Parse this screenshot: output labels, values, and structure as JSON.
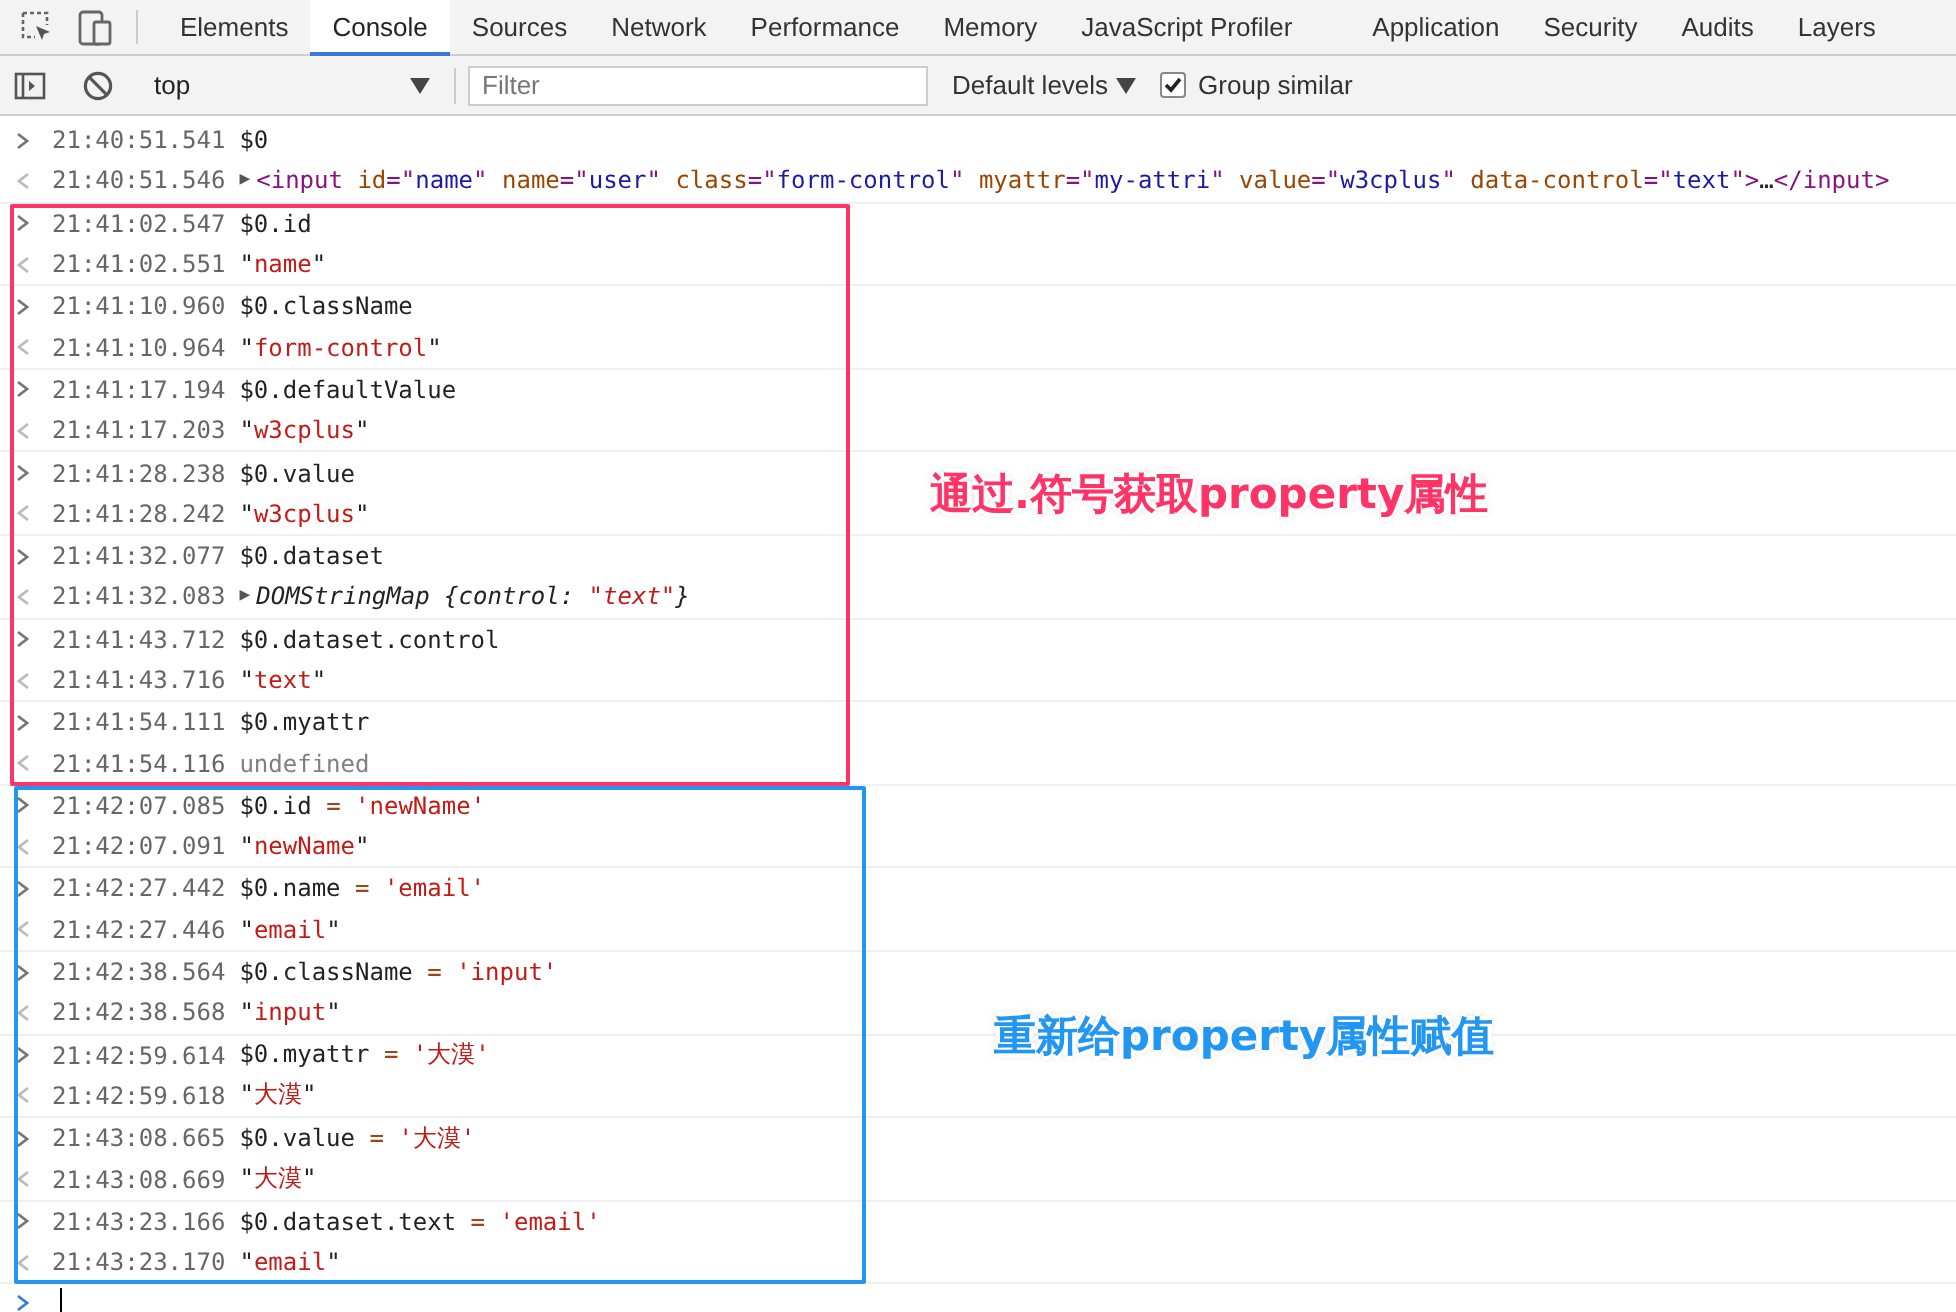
{
  "tabs": [
    {
      "label": "Elements",
      "selected": false
    },
    {
      "label": "Console",
      "selected": true
    },
    {
      "label": "Sources",
      "selected": false
    },
    {
      "label": "Network",
      "selected": false
    },
    {
      "label": "Performance",
      "selected": false
    },
    {
      "label": "Memory",
      "selected": false
    },
    {
      "label": "JavaScript Profiler",
      "selected": false
    },
    {
      "label": "Application",
      "selected": false
    },
    {
      "label": "Security",
      "selected": false
    },
    {
      "label": "Audits",
      "selected": false
    },
    {
      "label": "Layers",
      "selected": false
    }
  ],
  "toolbar": {
    "context": "top",
    "filter": {
      "placeholder": "Filter"
    },
    "levels": "Default levels",
    "group_similar": {
      "label": "Group similar",
      "checked": true
    }
  },
  "groups": [
    {
      "entries": [
        {
          "kind": "input",
          "time": "21:40:51.541",
          "tokens": [
            {
              "kind": "plain",
              "text": "$0"
            }
          ]
        },
        {
          "kind": "output",
          "time": "21:40:51.546",
          "expander": "▶",
          "tokens": [
            {
              "kind": "tag",
              "text": "<input"
            },
            {
              "kind": "attr",
              "text": " id"
            },
            {
              "kind": "tag",
              "text": "=\""
            },
            {
              "kind": "attrval",
              "text": "name"
            },
            {
              "kind": "tag",
              "text": "\""
            },
            {
              "kind": "attr",
              "text": " name"
            },
            {
              "kind": "tag",
              "text": "=\""
            },
            {
              "kind": "attrval",
              "text": "user"
            },
            {
              "kind": "tag",
              "text": "\""
            },
            {
              "kind": "attr",
              "text": " class"
            },
            {
              "kind": "tag",
              "text": "=\""
            },
            {
              "kind": "attrval",
              "text": "form-control"
            },
            {
              "kind": "tag",
              "text": "\""
            },
            {
              "kind": "attr",
              "text": " myattr"
            },
            {
              "kind": "tag",
              "text": "=\""
            },
            {
              "kind": "attrval",
              "text": "my-attri"
            },
            {
              "kind": "tag",
              "text": "\""
            },
            {
              "kind": "attr",
              "text": " value"
            },
            {
              "kind": "tag",
              "text": "=\""
            },
            {
              "kind": "attrval",
              "text": "w3cplus"
            },
            {
              "kind": "tag",
              "text": "\""
            },
            {
              "kind": "attr",
              "text": " data-control"
            },
            {
              "kind": "tag",
              "text": "=\""
            },
            {
              "kind": "attrval",
              "text": "text"
            },
            {
              "kind": "tag",
              "text": "\">"
            },
            {
              "kind": "plain",
              "text": "…"
            },
            {
              "kind": "tag",
              "text": "</input>"
            }
          ]
        }
      ]
    },
    {
      "annotation": {
        "text": "通过.符号获取property属性",
        "color": "#ff3366"
      },
      "entries": [
        {
          "kind": "input",
          "time": "21:41:02.547",
          "tokens": [
            {
              "kind": "plain",
              "text": "$0.id"
            }
          ]
        },
        {
          "kind": "output",
          "time": "21:41:02.551",
          "tokens": [
            {
              "kind": "plain",
              "text": "\""
            },
            {
              "kind": "string",
              "text": "name"
            },
            {
              "kind": "plain",
              "text": "\""
            }
          ]
        },
        {
          "kind": "input",
          "time": "21:41:10.960",
          "tokens": [
            {
              "kind": "plain",
              "text": "$0.className"
            }
          ]
        },
        {
          "kind": "output",
          "time": "21:41:10.964",
          "tokens": [
            {
              "kind": "plain",
              "text": "\""
            },
            {
              "kind": "string",
              "text": "form-control"
            },
            {
              "kind": "plain",
              "text": "\""
            }
          ]
        },
        {
          "kind": "input",
          "time": "21:41:17.194",
          "tokens": [
            {
              "kind": "plain",
              "text": "$0.defaultValue"
            }
          ]
        },
        {
          "kind": "output",
          "time": "21:41:17.203",
          "tokens": [
            {
              "kind": "plain",
              "text": "\""
            },
            {
              "kind": "string",
              "text": "w3cplus"
            },
            {
              "kind": "plain",
              "text": "\""
            }
          ]
        },
        {
          "kind": "input",
          "time": "21:41:28.238",
          "tokens": [
            {
              "kind": "plain",
              "text": "$0.value"
            }
          ]
        },
        {
          "kind": "output",
          "time": "21:41:28.242",
          "tokens": [
            {
              "kind": "plain",
              "text": "\""
            },
            {
              "kind": "string",
              "text": "w3cplus"
            },
            {
              "kind": "plain",
              "text": "\""
            }
          ]
        },
        {
          "kind": "input",
          "time": "21:41:32.077",
          "tokens": [
            {
              "kind": "plain",
              "text": "$0.dataset"
            }
          ]
        },
        {
          "kind": "output",
          "time": "21:41:32.083",
          "expander": "▶",
          "tokens": [
            {
              "kind": "italic",
              "text": "DOMStringMap {control: "
            },
            {
              "kind": "istring",
              "text": "\"text\""
            },
            {
              "kind": "italic",
              "text": "}"
            }
          ]
        },
        {
          "kind": "input",
          "time": "21:41:43.712",
          "tokens": [
            {
              "kind": "plain",
              "text": "$0.dataset.control"
            }
          ]
        },
        {
          "kind": "output",
          "time": "21:41:43.716",
          "tokens": [
            {
              "kind": "plain",
              "text": "\""
            },
            {
              "kind": "string",
              "text": "text"
            },
            {
              "kind": "plain",
              "text": "\""
            }
          ]
        },
        {
          "kind": "input",
          "time": "21:41:54.111",
          "tokens": [
            {
              "kind": "plain",
              "text": "$0.myattr"
            }
          ]
        },
        {
          "kind": "output",
          "time": "21:41:54.116",
          "tokens": [
            {
              "kind": "muted",
              "text": "undefined"
            }
          ]
        }
      ]
    },
    {
      "annotation": {
        "text": "重新给property属性赋值",
        "color": "#2196f3"
      },
      "entries": [
        {
          "kind": "input",
          "time": "21:42:07.085",
          "tokens": [
            {
              "kind": "plain",
              "text": "$0.id "
            },
            {
              "kind": "operator",
              "text": "="
            },
            {
              "kind": "string",
              "text": " 'newName'"
            }
          ]
        },
        {
          "kind": "output",
          "time": "21:42:07.091",
          "tokens": [
            {
              "kind": "plain",
              "text": "\""
            },
            {
              "kind": "string",
              "text": "newName"
            },
            {
              "kind": "plain",
              "text": "\""
            }
          ]
        },
        {
          "kind": "input",
          "time": "21:42:27.442",
          "tokens": [
            {
              "kind": "plain",
              "text": "$0.name "
            },
            {
              "kind": "operator",
              "text": "="
            },
            {
              "kind": "string",
              "text": " 'email'"
            }
          ]
        },
        {
          "kind": "output",
          "time": "21:42:27.446",
          "tokens": [
            {
              "kind": "plain",
              "text": "\""
            },
            {
              "kind": "string",
              "text": "email"
            },
            {
              "kind": "plain",
              "text": "\""
            }
          ]
        },
        {
          "kind": "input",
          "time": "21:42:38.564",
          "tokens": [
            {
              "kind": "plain",
              "text": "$0.className "
            },
            {
              "kind": "operator",
              "text": "="
            },
            {
              "kind": "string",
              "text": " 'input'"
            }
          ]
        },
        {
          "kind": "output",
          "time": "21:42:38.568",
          "tokens": [
            {
              "kind": "plain",
              "text": "\""
            },
            {
              "kind": "string",
              "text": "input"
            },
            {
              "kind": "plain",
              "text": "\""
            }
          ]
        },
        {
          "kind": "input",
          "time": "21:42:59.614",
          "tokens": [
            {
              "kind": "plain",
              "text": "$0.myattr "
            },
            {
              "kind": "operator",
              "text": "="
            },
            {
              "kind": "string",
              "text": " '大漠'"
            }
          ]
        },
        {
          "kind": "output",
          "time": "21:42:59.618",
          "tokens": [
            {
              "kind": "plain",
              "text": "\""
            },
            {
              "kind": "string",
              "text": "大漠"
            },
            {
              "kind": "plain",
              "text": "\""
            }
          ]
        },
        {
          "kind": "input",
          "time": "21:43:08.665",
          "tokens": [
            {
              "kind": "plain",
              "text": "$0.value "
            },
            {
              "kind": "operator",
              "text": "="
            },
            {
              "kind": "string",
              "text": " '大漠'"
            }
          ]
        },
        {
          "kind": "output",
          "time": "21:43:08.669",
          "tokens": [
            {
              "kind": "plain",
              "text": "\""
            },
            {
              "kind": "string",
              "text": "大漠"
            },
            {
              "kind": "plain",
              "text": "\""
            }
          ]
        },
        {
          "kind": "input",
          "time": "21:43:23.166",
          "tokens": [
            {
              "kind": "plain",
              "text": "$0.dataset.text "
            },
            {
              "kind": "operator",
              "text": "="
            },
            {
              "kind": "string",
              "text": " 'email'"
            }
          ]
        },
        {
          "kind": "output",
          "time": "21:43:23.170",
          "tokens": [
            {
              "kind": "plain",
              "text": "\""
            },
            {
              "kind": "string",
              "text": "email"
            },
            {
              "kind": "plain",
              "text": "\""
            }
          ]
        }
      ]
    }
  ]
}
